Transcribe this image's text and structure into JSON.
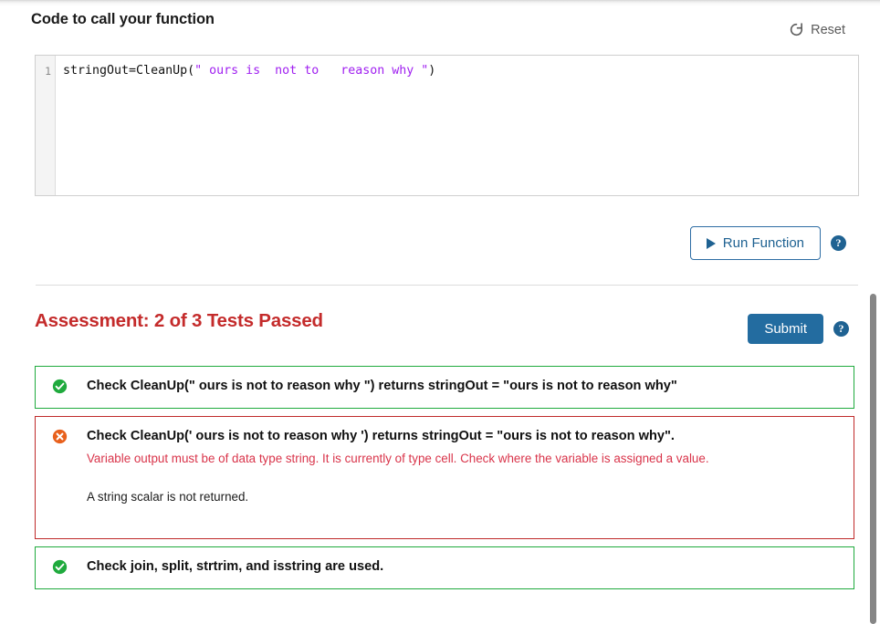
{
  "header": {
    "section_title": "Code to call your function",
    "reset_label": "Reset",
    "reset_icon": "refresh-icon"
  },
  "editor": {
    "line_number": "1",
    "code_prefix": "stringOut=CleanUp(",
    "code_string": "\" ours is  not to   reason why \"",
    "code_suffix": ")",
    "string_color": "#a020f0"
  },
  "actions": {
    "run_label": "Run Function",
    "run_icon": "play-icon",
    "run_help_icon": "help-icon",
    "submit_label": "Submit",
    "submit_help_icon": "help-icon",
    "accent_blue": "#1f6292",
    "submit_bg": "#236ca0"
  },
  "assessment": {
    "title": "Assessment: 2 of 3 Tests Passed",
    "title_color": "#c42b2b",
    "pass_color": "#1faa3d",
    "fail_color": "#bf2a2a",
    "tests": [
      {
        "status": "pass",
        "icon": "check-circle-icon",
        "text": "Check CleanUp(\" ours is not to reason why \") returns stringOut = \"ours is not to reason why\"",
        "error": "",
        "note": ""
      },
      {
        "status": "fail",
        "icon": "error-circle-icon",
        "text": "Check CleanUp(' ours is not to reason why ') returns stringOut = \"ours is not to reason why\".",
        "error": "Variable output must be of data type string. It is currently of type cell. Check where the variable is assigned a value.",
        "note": "A string scalar is not returned."
      },
      {
        "status": "pass",
        "icon": "check-circle-icon",
        "text": "Check join, split, strtrim, and isstring are used.",
        "error": "",
        "note": ""
      }
    ]
  },
  "scrollbar": {
    "orientation": "vertical"
  }
}
